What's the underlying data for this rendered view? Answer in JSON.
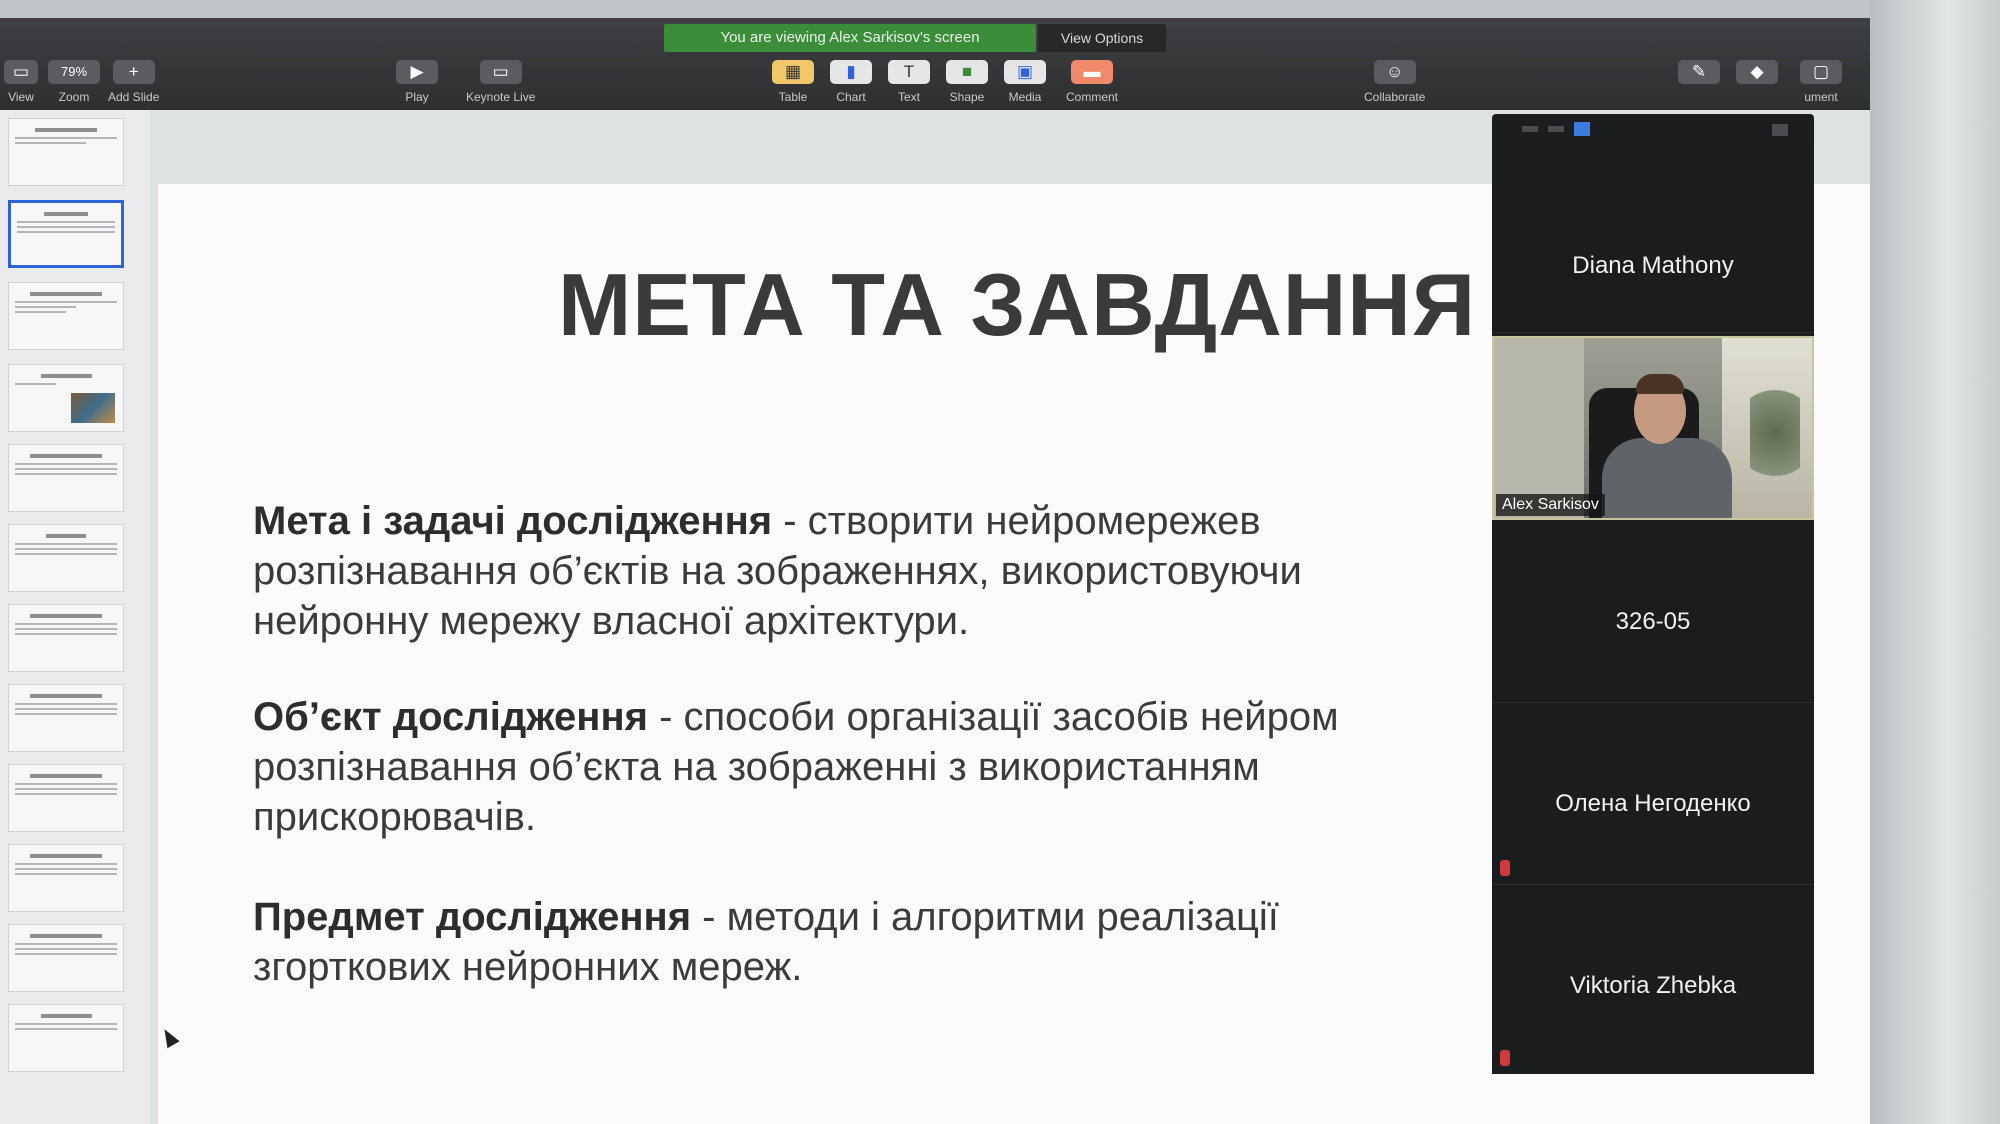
{
  "toolbar": {
    "view_label": "View",
    "zoom_value": "79%",
    "zoom_label": "Zoom",
    "add_slide_label": "Add Slide",
    "play_label": "Play",
    "keynote_live_label": "Keynote Live",
    "insert": [
      {
        "label": "Table",
        "icon": "table-icon"
      },
      {
        "label": "Chart",
        "icon": "chart-icon"
      },
      {
        "label": "Text",
        "icon": "text-icon"
      },
      {
        "label": "Shape",
        "icon": "shape-icon"
      },
      {
        "label": "Media",
        "icon": "media-icon"
      },
      {
        "label": "Comment",
        "icon": "comment-icon"
      }
    ],
    "collaborate_label": "Collaborate",
    "document_label_partial": "ument"
  },
  "share_banner": {
    "text": "You are viewing Alex Sarkisov's screen",
    "view_options": "View Options"
  },
  "slide": {
    "title": "МЕТА ТА ЗАВДАННЯ",
    "paragraphs": [
      {
        "heading": "Мета і задачі дослідження",
        "text": " - створити нейромережев розпізнавання об’єктів на зображеннях, використовуючи нейронну мережу власної архітектури."
      },
      {
        "heading": "Об’єкт дослідження",
        "text": " - способи організації засобів нейром розпізнавання об’єкта на зображенні з використанням прискорювачів."
      },
      {
        "heading": "Предмет дослідження",
        "text": " - методи і алгоритми реалізації згорткових нейронних мереж."
      }
    ]
  },
  "navigator": {
    "thumbnail_count": 12,
    "active_index": 1
  },
  "participants": [
    {
      "name": "Diana Mathony",
      "video": false
    },
    {
      "name": "Alex Sarkisov",
      "video": true
    },
    {
      "name": "326-05",
      "video": false
    },
    {
      "name": "Олена Негоденко",
      "video": false,
      "muted": true
    },
    {
      "name": "Viktoria Zhebka",
      "video": false,
      "muted": true
    }
  ],
  "colors": {
    "banner_green": "#3c8d3a",
    "active_thumb": "#2f64d8",
    "muted_red": "#d13a3a"
  }
}
